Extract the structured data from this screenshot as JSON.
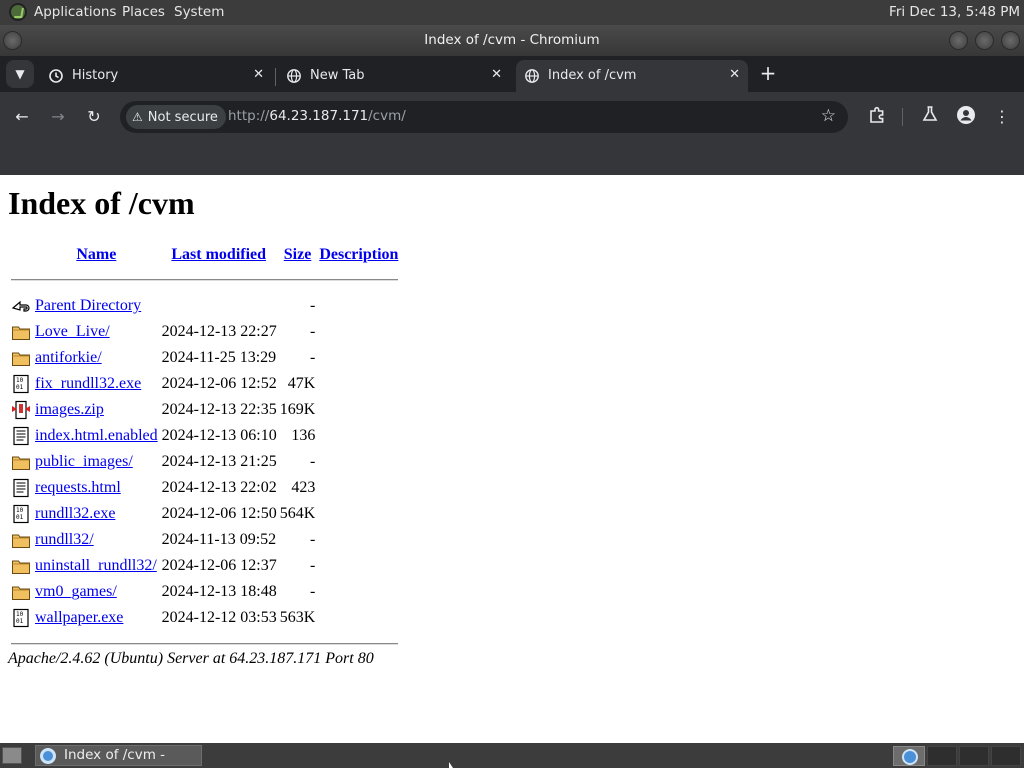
{
  "top_panel": {
    "menus": [
      "Applications",
      "Places",
      "System"
    ],
    "clock": "Fri Dec 13,  5:48 PM"
  },
  "window": {
    "title": "Index of /cvm - Chromium"
  },
  "tabs": [
    {
      "label": "History",
      "icon": "history-icon",
      "active": false
    },
    {
      "label": "New Tab",
      "icon": "globe-icon",
      "active": false
    },
    {
      "label": "Index of /cvm",
      "icon": "globe-icon",
      "active": true
    }
  ],
  "toolbar": {
    "security_label": "Not secure",
    "url_scheme": "http://",
    "url_host": "64.23.187.171",
    "url_path": "/cvm/"
  },
  "page": {
    "heading": "Index of /cvm",
    "columns": {
      "name": "Name",
      "modified": "Last modified",
      "size": "Size",
      "description": "Description"
    },
    "rows": [
      {
        "icon": "parent-dir-icon",
        "name": "Parent Directory",
        "modified": "",
        "size": "-"
      },
      {
        "icon": "folder-icon",
        "name": "Love_Live/",
        "modified": "2024-12-13 22:27",
        "size": "-"
      },
      {
        "icon": "folder-icon",
        "name": "antiforkie/",
        "modified": "2024-11-25 13:29",
        "size": "-"
      },
      {
        "icon": "binary-file-icon",
        "name": "fix_rundll32.exe",
        "modified": "2024-12-06 12:52",
        "size": "47K"
      },
      {
        "icon": "compressed-file-icon",
        "name": "images.zip",
        "modified": "2024-12-13 22:35",
        "size": "169K"
      },
      {
        "icon": "text-file-icon",
        "name": "index.html.enabled",
        "modified": "2024-12-13 06:10",
        "size": "136"
      },
      {
        "icon": "folder-icon",
        "name": "public_images/",
        "modified": "2024-12-13 21:25",
        "size": "-"
      },
      {
        "icon": "text-file-icon",
        "name": "requests.html",
        "modified": "2024-12-13 22:02",
        "size": "423"
      },
      {
        "icon": "binary-file-icon",
        "name": "rundll32.exe",
        "modified": "2024-12-06 12:50",
        "size": "564K"
      },
      {
        "icon": "folder-icon",
        "name": "rundll32/",
        "modified": "2024-11-13 09:52",
        "size": "-"
      },
      {
        "icon": "folder-icon",
        "name": "uninstall_rundll32/",
        "modified": "2024-12-06 12:37",
        "size": "-"
      },
      {
        "icon": "folder-icon",
        "name": "vm0_games/",
        "modified": "2024-12-13 18:48",
        "size": "-"
      },
      {
        "icon": "binary-file-icon",
        "name": "wallpaper.exe",
        "modified": "2024-12-12 03:53",
        "size": "563K"
      }
    ],
    "server_signature": "Apache/2.4.62 (Ubuntu) Server at 64.23.187.171 Port 80"
  },
  "taskbar": {
    "task_label": "Index of /cvm - Chr..."
  }
}
